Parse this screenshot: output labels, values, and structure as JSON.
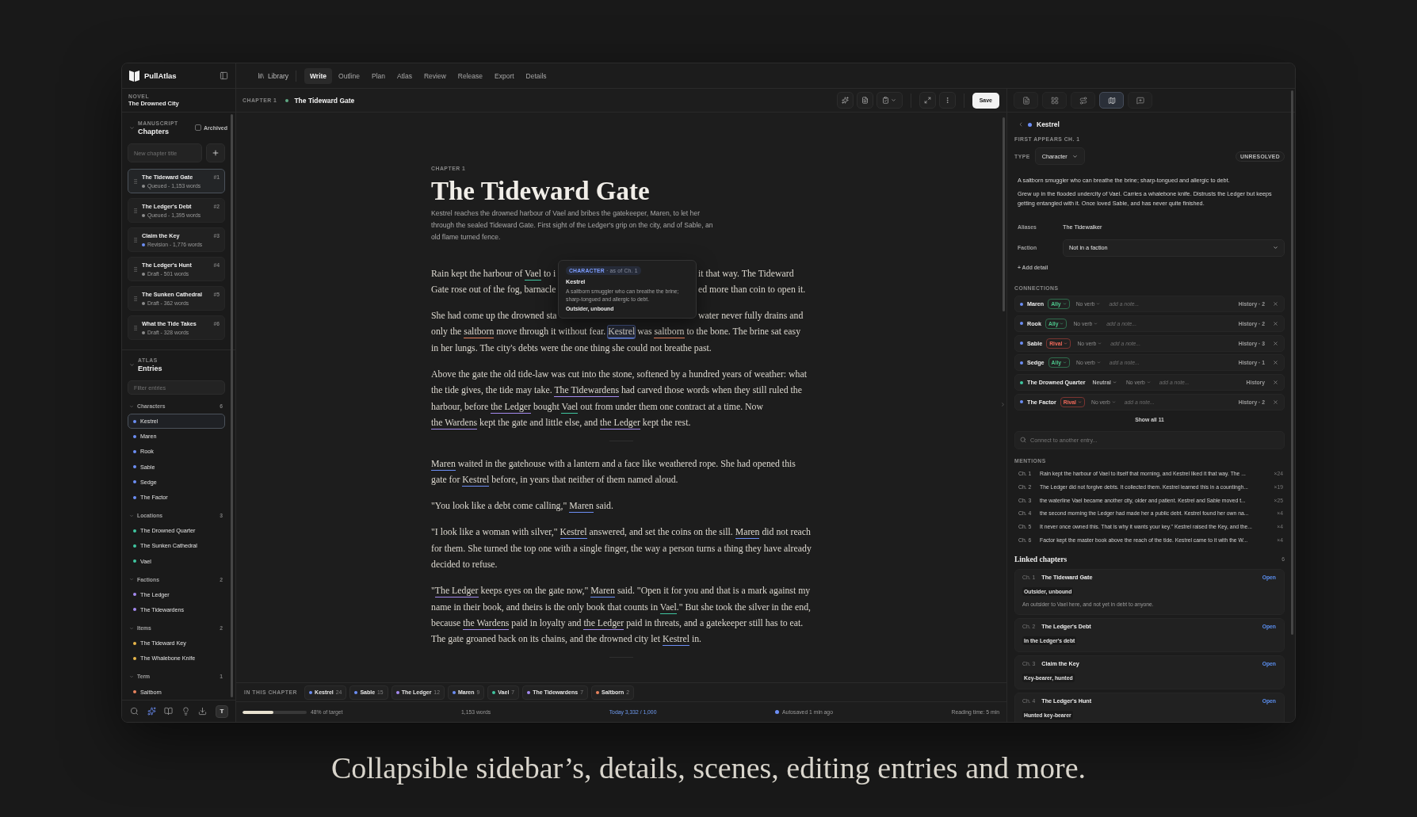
{
  "sidebar": {
    "brand": "PullAtlas",
    "novel_label": "NOVEL",
    "novel_title": "The Drowned City",
    "manuscript": {
      "eyebrow": "MANUSCRIPT",
      "title": "Chapters",
      "expanded": true,
      "archived": {
        "label": "Archived",
        "checked": false
      },
      "new_chapter": {
        "placeholder": "New chapter title"
      },
      "chapters": [
        {
          "title": "The Tideward Gate",
          "number": "#1",
          "status": "Queued - 1,153 words",
          "color": "#8b8b8b",
          "selected": true
        },
        {
          "title": "The Ledger's Debt",
          "number": "#2",
          "status": "Queued - 1,395 words",
          "color": "#8b8b8b",
          "selected": false
        },
        {
          "title": "Claim the Key",
          "number": "#3",
          "status": "Revision - 1,776 words",
          "color": "#6c8ef5",
          "selected": false
        },
        {
          "title": "The Ledger's Hunt",
          "number": "#4",
          "status": "Draft - 501 words",
          "color": "#8b8b8b",
          "selected": false
        },
        {
          "title": "The Sunken Cathedral",
          "number": "#5",
          "status": "Draft - 362 words",
          "color": "#8b8b8b",
          "selected": false
        },
        {
          "title": "What the Tide Takes",
          "number": "#6",
          "status": "Draft - 328 words",
          "color": "#8b8b8b",
          "selected": false
        }
      ]
    },
    "atlas": {
      "eyebrow": "ATLAS",
      "title": "Entries",
      "expanded": true,
      "filter": {
        "placeholder": "Filter entries"
      },
      "groups": [
        {
          "label": "Characters",
          "count": "6",
          "color": "#6c8ef5",
          "expanded": true,
          "items": [
            {
              "label": "Kestrel",
              "selected": true
            },
            {
              "label": "Maren",
              "selected": false
            },
            {
              "label": "Rook",
              "selected": false
            },
            {
              "label": "Sable",
              "selected": false
            },
            {
              "label": "Sedge",
              "selected": false
            },
            {
              "label": "The Factor",
              "selected": false
            }
          ]
        },
        {
          "label": "Locations",
          "count": "3",
          "color": "#3fc6a0",
          "expanded": true,
          "items": [
            {
              "label": "The Drowned Quarter",
              "selected": false
            },
            {
              "label": "The Sunken Cathedral",
              "selected": false
            },
            {
              "label": "Vael",
              "selected": false
            }
          ]
        },
        {
          "label": "Factions",
          "count": "2",
          "color": "#a48af0",
          "expanded": true,
          "items": [
            {
              "label": "The Ledger",
              "selected": false
            },
            {
              "label": "The Tidewardens",
              "selected": false
            }
          ]
        },
        {
          "label": "Items",
          "count": "2",
          "color": "#e8b64a",
          "expanded": true,
          "items": [
            {
              "label": "The Tideward Key",
              "selected": false
            },
            {
              "label": "The Whalebone Knife",
              "selected": false
            }
          ]
        },
        {
          "label": "Term",
          "count": "1",
          "color": "#e9835e",
          "expanded": true,
          "items": [
            {
              "label": "Saltborn",
              "selected": false
            }
          ]
        }
      ]
    },
    "tools": [
      {
        "kind": "search",
        "on": false
      },
      {
        "kind": "sparkle",
        "on": true
      },
      {
        "kind": "book",
        "on": false
      },
      {
        "kind": "bulb",
        "on": false
      },
      {
        "kind": "download",
        "on": false
      },
      {
        "kind": "letter",
        "label": "T",
        "on": true
      }
    ]
  },
  "nav": {
    "library": "Library",
    "tabs": [
      {
        "label": "Write",
        "selected": true
      },
      {
        "label": "Outline",
        "selected": false
      },
      {
        "label": "Plan",
        "selected": false
      },
      {
        "label": "Atlas",
        "selected": false
      },
      {
        "label": "Review",
        "selected": false
      },
      {
        "label": "Release",
        "selected": false
      },
      {
        "label": "Export",
        "selected": false
      },
      {
        "label": "Details",
        "selected": false
      }
    ]
  },
  "chapter_bar": {
    "eyebrow": "CHAPTER 1",
    "title": "The Tideward Gate",
    "save": "Save"
  },
  "editor": {
    "eyebrow": "CHAPTER 1",
    "title": "The Tideward Gate",
    "summary": "Kestrel reaches the drowned harbour of Vael and bribes the gatekeeper, Maren, to let her through the sealed Tideward Gate. First sight of the Ledger's grip on the city, and of Sable, an old flame turned fence.",
    "body": [
      {
        "kind": "cut",
        "lines": [
          {
            "left": [
              "Rain kept the harbour of ",
              {
                "mention": "Vael",
                "color": "#3fc6a0",
                "hovered": false
              },
              " to i"
            ],
            "right": [
              "it that way. The Tideward"
            ]
          },
          {
            "left": [
              "Gate rose out of the fog, barnacle"
            ],
            "right": [
              "ed more than coin to open it."
            ]
          }
        ]
      },
      {
        "kind": "cut",
        "lines": [
          {
            "left": [
              "She had come up the drowned sta"
            ],
            "right": [
              "water never fully drains and"
            ]
          },
          {
            "left": [
              "only the ",
              {
                "mention": "saltborn",
                "color": "#e9835e",
                "hovered": false
              },
              " move through it without fear. ",
              {
                "mention": "Kestrel",
                "color": "#6c8ef5",
                "hovered": true
              },
              " was ",
              {
                "mention": "saltborn",
                "color": "#e9835e",
                "hovered": false
              },
              " to the bone. The brine sat easy"
            ]
          },
          {
            "left": [
              "in her lungs. The city's debts were the one thing she could not breathe past."
            ]
          }
        ]
      },
      {
        "kind": "text",
        "segments": [
          "Above the gate the old tide-law was cut into the stone, softened by a hundred years of weather: what the tide gives, the tide may take. ",
          {
            "mention": "The Tidewardens",
            "color": "#a48af0",
            "hovered": false
          },
          " had carved those words when they still ruled the harbour, before ",
          {
            "mention": "the Ledger",
            "color": "#a48af0",
            "hovered": false
          },
          " bought ",
          {
            "mention": "Vael",
            "color": "#3fc6a0",
            "hovered": false
          },
          " out from under them one contract at a time. Now ",
          {
            "mention": "the Wardens",
            "color": "#a48af0",
            "hovered": false
          },
          " kept the gate and little else, and ",
          {
            "mention": "the Ledger",
            "color": "#a48af0",
            "hovered": false
          },
          " kept the rest."
        ]
      },
      {
        "kind": "break"
      },
      {
        "kind": "text",
        "segments": [
          {
            "mention": "Maren",
            "color": "#6c8ef5",
            "hovered": false
          },
          " waited in the gatehouse with a lantern and a face like weathered rope. She had opened this gate for ",
          {
            "mention": "Kestrel",
            "color": "#6c8ef5",
            "hovered": false
          },
          " before, in years that neither of them named aloud."
        ]
      },
      {
        "kind": "text",
        "segments": [
          "\"You look like a debt come calling,\" ",
          {
            "mention": "Maren",
            "color": "#6c8ef5",
            "hovered": false
          },
          " said."
        ]
      },
      {
        "kind": "text",
        "segments": [
          "\"I look like a woman with silver,\" ",
          {
            "mention": "Kestrel",
            "color": "#6c8ef5",
            "hovered": false
          },
          " answered, and set the coins on the sill. ",
          {
            "mention": "Maren",
            "color": "#6c8ef5",
            "hovered": false
          },
          " did not reach for them. She turned the top one with a single finger, the way a person turns a thing they have already decided to refuse."
        ]
      },
      {
        "kind": "text",
        "segments": [
          "\"",
          {
            "mention": "The Ledger",
            "color": "#a48af0",
            "hovered": false
          },
          " keeps eyes on the gate now,\" ",
          {
            "mention": "Maren",
            "color": "#6c8ef5",
            "hovered": false
          },
          " said. \"Open it for you and that is a mark against my name in their book, and theirs is the only book that counts in ",
          {
            "mention": "Vael",
            "color": "#3fc6a0",
            "hovered": false
          },
          ".\" But she took the silver in the end, because ",
          {
            "mention": "the Wardens",
            "color": "#a48af0",
            "hovered": false
          },
          " paid in loyalty and ",
          {
            "mention": "the Ledger",
            "color": "#a48af0",
            "hovered": false
          },
          " paid in threats, and a gatekeeper still has to eat. The gate groaned back on its chains, and the drowned city let ",
          {
            "mention": "Kestrel",
            "color": "#6c8ef5",
            "hovered": false
          },
          " in."
        ]
      },
      {
        "kind": "break"
      }
    ],
    "tooltip": {
      "badge": "**CHARACTER** · as of Ch. 1",
      "name": "Kestrel",
      "description": "A saltborn smuggler who can breathe the brine; sharp-tongued and allergic to debt.",
      "tag": "Outsider, unbound"
    }
  },
  "chapter_entities": {
    "label": "IN THIS CHAPTER",
    "chips": [
      {
        "name": "Kestrel",
        "count": "24",
        "color": "#6c8ef5"
      },
      {
        "name": "Sable",
        "count": "15",
        "color": "#6c8ef5"
      },
      {
        "name": "The Ledger",
        "count": "12",
        "color": "#a48af0"
      },
      {
        "name": "Maren",
        "count": "9",
        "color": "#6c8ef5"
      },
      {
        "name": "Vael",
        "count": "7",
        "color": "#3fc6a0"
      },
      {
        "name": "The Tidewardens",
        "count": "7",
        "color": "#a48af0"
      },
      {
        "name": "Saltborn",
        "count": "2",
        "color": "#e9835e"
      }
    ]
  },
  "status_bar": {
    "progress": {
      "level": 0.48,
      "label": "48% of target"
    },
    "words": "1,153 words",
    "today": "Today 3,332 / 1,000",
    "autosave": "Autosaved 1 min ago",
    "reading_time": "Reading time: 5 min"
  },
  "inspector": {
    "tabs": [
      {
        "kind": "document",
        "selected": false
      },
      {
        "kind": "grid",
        "selected": false
      },
      {
        "kind": "links",
        "selected": false
      },
      {
        "kind": "map",
        "selected": true
      },
      {
        "kind": "comment",
        "selected": false
      }
    ],
    "entry": {
      "name": "Kestrel",
      "color": "#6c8ef5",
      "first_appears": "FIRST APPEARS CH. 1",
      "type_label": "TYPE",
      "type": "Character",
      "status": "UNRESOLVED",
      "description": [
        "A saltborn smuggler who can breathe the brine; sharp-tongued and allergic to debt.",
        "Grew up in the flooded undercity of Vael. Carries a whalebone knife. Distrusts the Ledger but keeps getting entangled with it. Once loved Sable, and has never quite finished."
      ],
      "details": [
        {
          "kind": "text",
          "label": "Aliases",
          "value": "The Tidewalker"
        },
        {
          "kind": "select",
          "label": "Faction",
          "value": "Not in a faction"
        }
      ],
      "add_detail": "+ Add detail",
      "connections_label": "CONNECTIONS",
      "connections": [
        {
          "name": "Maren",
          "color": "#6c8ef5",
          "relation": {
            "kind": "ally",
            "label": "Ally"
          },
          "verb": "No verb",
          "note_placeholder": "add a note...",
          "history": "History · 2"
        },
        {
          "name": "Rook",
          "color": "#6c8ef5",
          "relation": {
            "kind": "ally",
            "label": "Ally"
          },
          "verb": "No verb",
          "note_placeholder": "add a note...",
          "history": "History · 2"
        },
        {
          "name": "Sable",
          "color": "#6c8ef5",
          "relation": {
            "kind": "rival",
            "label": "Rival"
          },
          "verb": "No verb",
          "note_placeholder": "add a note...",
          "history": "History · 3"
        },
        {
          "name": "Sedge",
          "color": "#6c8ef5",
          "relation": {
            "kind": "ally",
            "label": "Ally"
          },
          "verb": "No verb",
          "note_placeholder": "add a note...",
          "history": "History · 1"
        },
        {
          "name": "The Drowned Quarter",
          "color": "#3fc6a0",
          "relation": {
            "kind": "neutral",
            "label": "Neutral"
          },
          "verb": "No verb",
          "note_placeholder": "add a note...",
          "history": "History"
        },
        {
          "name": "The Factor",
          "color": "#6c8ef5",
          "relation": {
            "kind": "rival",
            "label": "Rival"
          },
          "verb": "No verb",
          "note_placeholder": "add a note...",
          "history": "History · 2"
        }
      ],
      "show_all": "Show all 11",
      "connect": {
        "placeholder": "Connect to another entry..."
      },
      "mentions_label": "MENTIONS",
      "mentions": [
        {
          "chapter": "Ch. 1",
          "excerpt": "Rain kept the harbour of Vael to itself that morning, and Kestrel liked it that way. The ...",
          "count": "×24"
        },
        {
          "chapter": "Ch. 2",
          "excerpt": "The Ledger did not forgive debts. It collected them. Kestrel learned this in a countingh...",
          "count": "×19"
        },
        {
          "chapter": "Ch. 3",
          "excerpt": "the waterline Vael became another city, older and patient. Kestrel and Sable moved t...",
          "count": "×25"
        },
        {
          "chapter": "Ch. 4",
          "excerpt": "the second morning the Ledger had made her a public debt. Kestrel found her own na...",
          "count": "×4"
        },
        {
          "chapter": "Ch. 5",
          "excerpt": "It never once owned this. That is why it wants your key.\" Kestrel raised the Key, and the...",
          "count": "×4"
        },
        {
          "chapter": "Ch. 6",
          "excerpt": "Factor kept the master book above the reach of the tide. Kestrel came to it with the W...",
          "count": "×4"
        }
      ],
      "linked": {
        "title": "Linked chapters",
        "count": "6",
        "chapters": [
          {
            "chapter": "Ch. 1",
            "title": "The Tideward Gate",
            "action": "Open",
            "tag": "Outsider, unbound",
            "note": "An outsider to Vael here, and not yet in debt to anyone."
          },
          {
            "chapter": "Ch. 2",
            "title": "The Ledger's Debt",
            "action": "Open",
            "tag": "In the Ledger's debt"
          },
          {
            "chapter": "Ch. 3",
            "title": "Claim the Key",
            "action": "Open",
            "tag": "Key-bearer, hunted"
          },
          {
            "chapter": "Ch. 4",
            "title": "The Ledger's Hunt",
            "action": "Open",
            "tag": "Hunted key-bearer"
          }
        ]
      }
    }
  },
  "caption": "Collapsible sidebar’s, details, scenes, editing entries and more."
}
